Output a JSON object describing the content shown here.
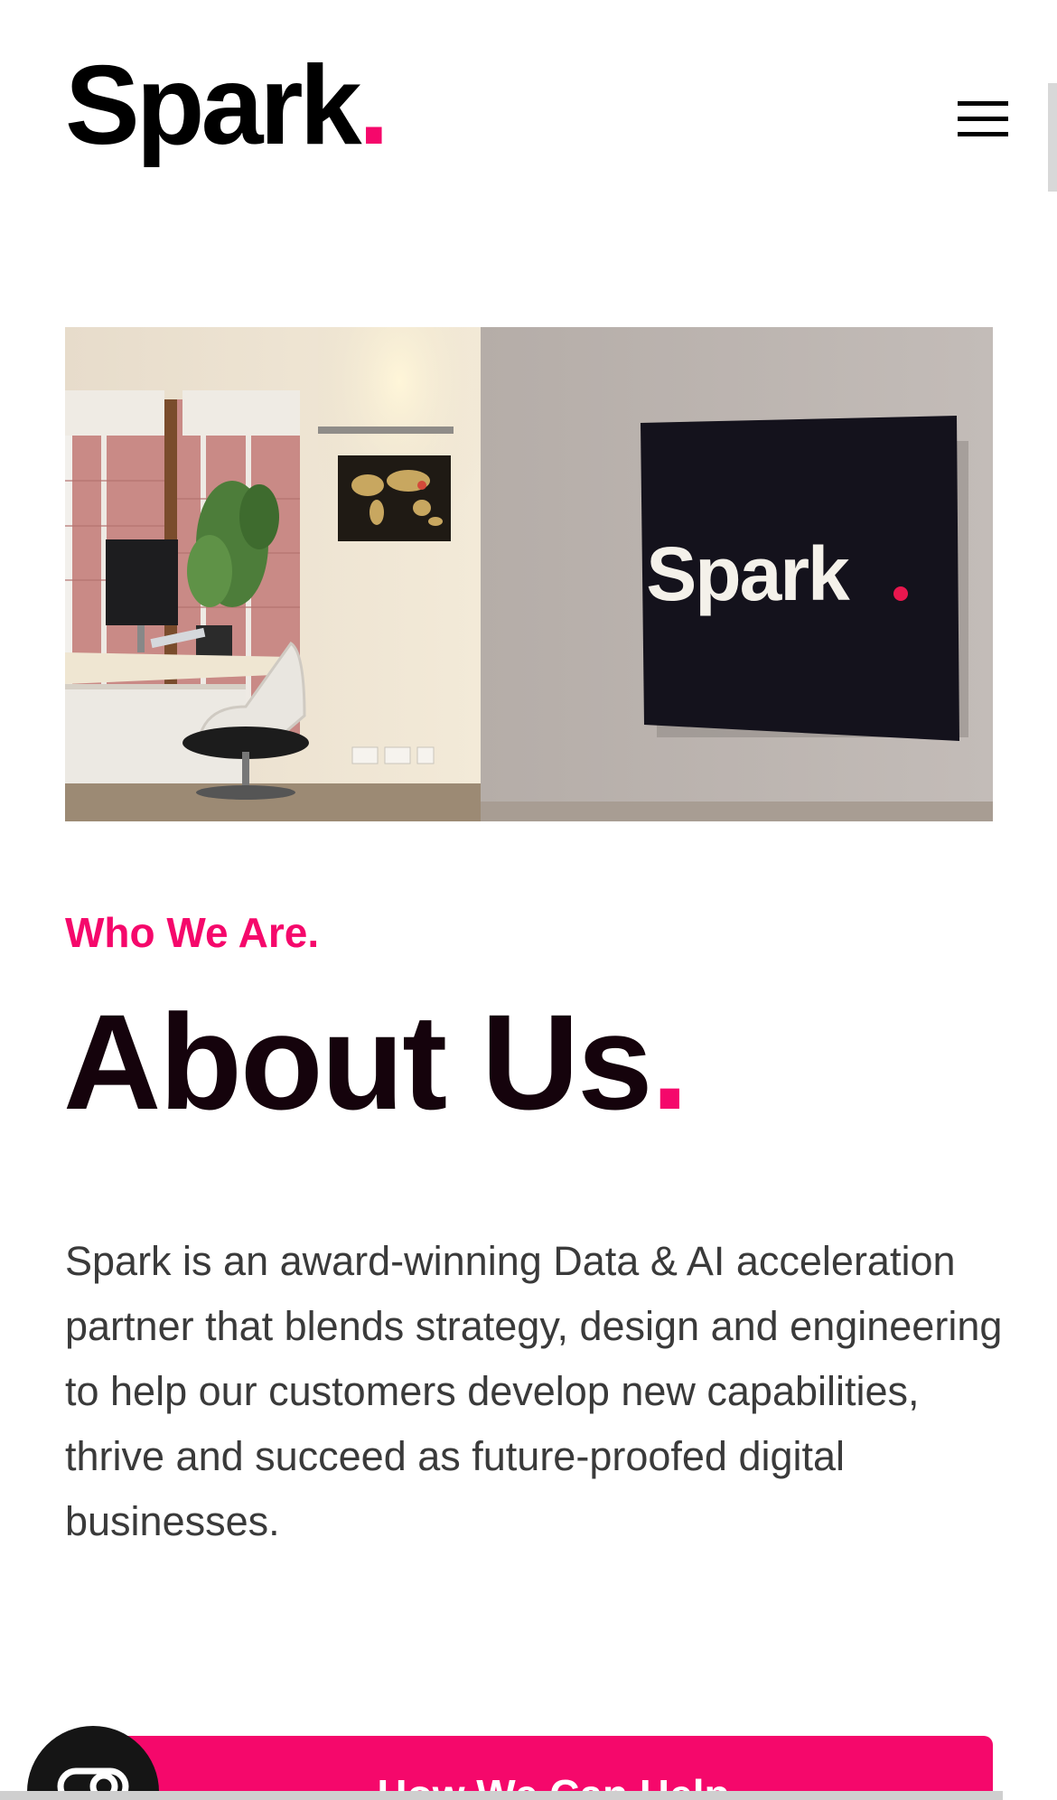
{
  "header": {
    "logo_text": "Spark",
    "logo_dot": ".",
    "menu_icon": "hamburger-menu-icon"
  },
  "hero": {
    "sign_text": "Spark",
    "sign_dot": "."
  },
  "section": {
    "eyebrow": "Who We Are.",
    "title": "About Us",
    "title_dot": ".",
    "body": "Spark is an award-winning Data & AI acceleration partner that blends strategy, design and engineering to help our customers develop new capabilities, thrive and succeed as future-proofed digital businesses."
  },
  "cta": {
    "label": "How We Can Help"
  },
  "cookie_button": {
    "icon": "cookie-toggle-icon"
  },
  "colors": {
    "accent": "#f5086b",
    "text_dark": "#15030c",
    "body_text": "#3a3a3a"
  }
}
